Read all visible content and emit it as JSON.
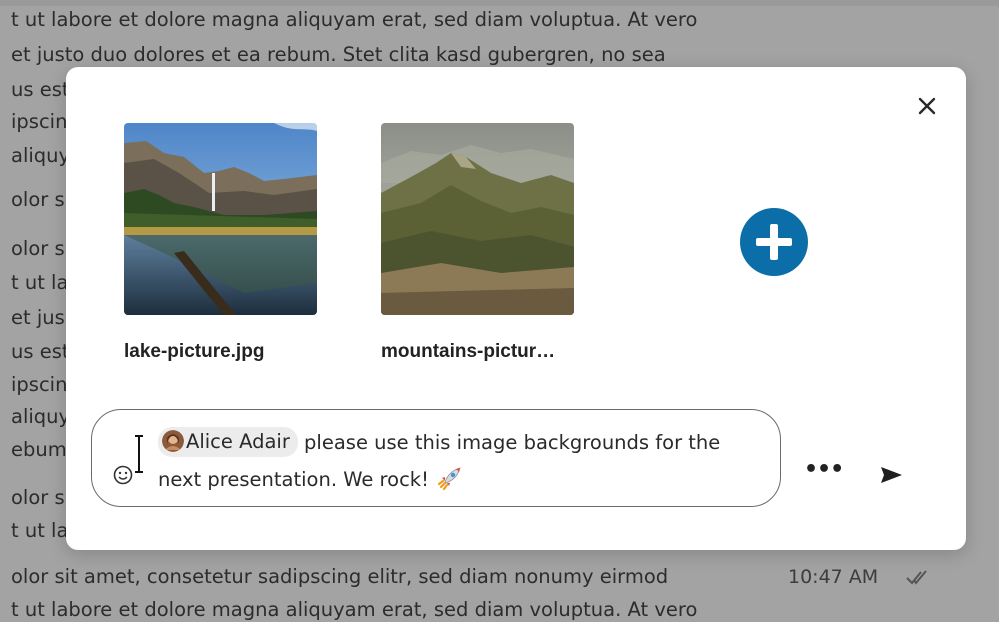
{
  "background_chat": {
    "lines": [
      "t ut labore et dolore magna aliquyam erat, sed diam voluptua. At vero",
      " et justo duo dolores et ea rebum. Stet clita kasd gubergren, no sea",
      "us est",
      "ipscin",
      "aliquy",
      "olor s",
      "olor s",
      "t ut la",
      " et jus",
      "us est",
      "ipscin",
      "aliquy",
      "ebum.",
      "olor s",
      "t ut la",
      "olor sit amet, consetetur sadipscing elitr, sed diam nonumy eirmod",
      "t ut labore et dolore magna aliquyam erat, sed diam voluptua. At vero"
    ],
    "timestamp": "10:47 AM",
    "read_receipt_icon": "double-check-icon"
  },
  "dialog": {
    "close_icon": "close-icon",
    "attachments": [
      {
        "file_name": "lake-picture.jpg",
        "thumbnail": "lake-image"
      },
      {
        "file_name": "mountains-pictur…",
        "thumbnail": "mountains-image"
      }
    ],
    "add_icon": "plus-circle-icon",
    "accent_color": "#0b6ea8",
    "composer": {
      "emoji_icon": "smiley-icon",
      "mention": "Alice Adair",
      "message_line1": " please use this image backgrounds for the",
      "message_line2": "next presentation. We rock! ",
      "rocket_icon": "rocket-icon"
    },
    "more_icon": "more-icon",
    "more_label": "•••",
    "send_icon": "send-icon"
  }
}
